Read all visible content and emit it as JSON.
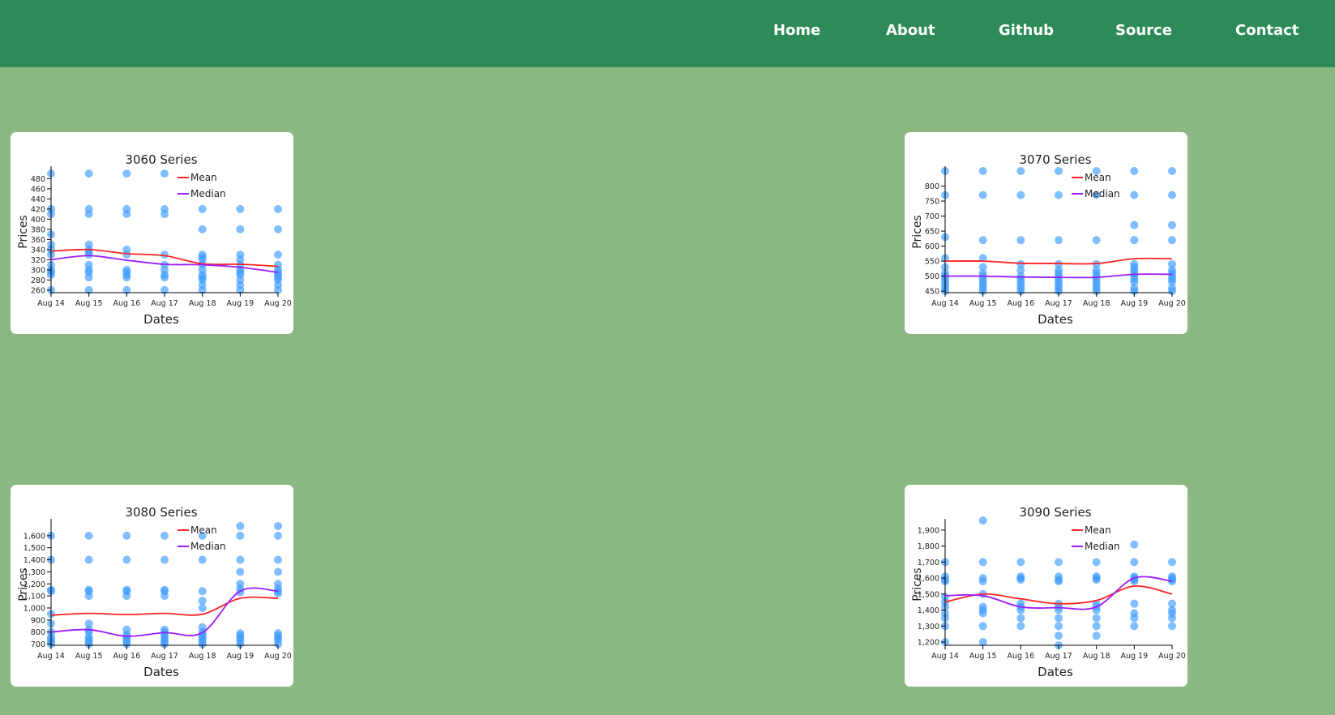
{
  "nav": {
    "items": [
      {
        "label": "Home"
      },
      {
        "label": "About"
      },
      {
        "label": "Github"
      },
      {
        "label": "Source"
      },
      {
        "label": "Contact"
      }
    ]
  },
  "colors": {
    "header": "#2e8b57",
    "background": "#8bb881",
    "mean": "#ff2222",
    "median": "#9b1bff",
    "points": "#3d9bff"
  },
  "chart_data": [
    {
      "type": "scatter",
      "title": "3060 Series",
      "xlabel": "Dates",
      "ylabel": "Prices",
      "categories": [
        "Aug 14",
        "Aug 15",
        "Aug 16",
        "Aug 17",
        "Aug 18",
        "Aug 19",
        "Aug 20"
      ],
      "yticks": [
        260,
        280,
        300,
        320,
        340,
        360,
        380,
        400,
        420,
        440,
        460,
        480
      ],
      "ylim": [
        255,
        495
      ],
      "tick_format": "plain",
      "points": [
        [
          490,
          420,
          410,
          370,
          350,
          340,
          330,
          310,
          300,
          295,
          290,
          260
        ],
        [
          490,
          420,
          410,
          350,
          340,
          335,
          330,
          310,
          300,
          295,
          285,
          260
        ],
        [
          490,
          420,
          410,
          340,
          330,
          300,
          295,
          290,
          285,
          260
        ],
        [
          490,
          420,
          410,
          330,
          310,
          300,
          290,
          285,
          260
        ],
        [
          420,
          380,
          330,
          325,
          320,
          310,
          300,
          290,
          285,
          280,
          270,
          260
        ],
        [
          420,
          380,
          330,
          320,
          310,
          300,
          295,
          290,
          280,
          270,
          260
        ],
        [
          420,
          380,
          330,
          310,
          300,
          295,
          290,
          285,
          280,
          270,
          260
        ]
      ],
      "series": [
        {
          "name": "Mean",
          "values": [
            337,
            340,
            332,
            328,
            312,
            311,
            307
          ]
        },
        {
          "name": "Median",
          "values": [
            320,
            328,
            319,
            311,
            310,
            305,
            295
          ]
        }
      ],
      "legend": "top-right"
    },
    {
      "type": "scatter",
      "title": "3070 Series",
      "xlabel": "Dates",
      "ylabel": "Prices",
      "categories": [
        "Aug 14",
        "Aug 15",
        "Aug 16",
        "Aug 17",
        "Aug 18",
        "Aug 19",
        "Aug 20"
      ],
      "yticks": [
        450,
        500,
        550,
        600,
        650,
        700,
        750,
        800
      ],
      "ylim": [
        445,
        850
      ],
      "tick_format": "plain",
      "points": [
        [
          850,
          770,
          630,
          560,
          530,
          510,
          500,
          490,
          480,
          470,
          460,
          450
        ],
        [
          850,
          770,
          620,
          560,
          530,
          510,
          500,
          490,
          480,
          470,
          460,
          450
        ],
        [
          850,
          770,
          620,
          540,
          520,
          500,
          490,
          480,
          470,
          460,
          450
        ],
        [
          850,
          770,
          620,
          540,
          520,
          510,
          500,
          490,
          480,
          470,
          460,
          450
        ],
        [
          850,
          770,
          620,
          540,
          520,
          510,
          500,
          490,
          480,
          470,
          460,
          450
        ],
        [
          850,
          770,
          670,
          620,
          540,
          530,
          520,
          510,
          500,
          490,
          480,
          460,
          450
        ],
        [
          850,
          770,
          670,
          620,
          540,
          520,
          510,
          500,
          490,
          480,
          460,
          450
        ]
      ],
      "series": [
        {
          "name": "Mean",
          "values": [
            550,
            550,
            543,
            542,
            542,
            558,
            558
          ]
        },
        {
          "name": "Median",
          "values": [
            500,
            500,
            497,
            496,
            496,
            506,
            506
          ]
        }
      ],
      "legend": "top-right"
    },
    {
      "type": "scatter",
      "title": "3080 Series",
      "xlabel": "Dates",
      "ylabel": "Prices",
      "categories": [
        "Aug 14",
        "Aug 15",
        "Aug 16",
        "Aug 17",
        "Aug 18",
        "Aug 19",
        "Aug 20"
      ],
      "yticks": [
        700,
        800,
        900,
        1000,
        1100,
        1200,
        1300,
        1400,
        1500,
        1600
      ],
      "ylim": [
        690,
        1700
      ],
      "tick_format": "comma",
      "points": [
        [
          1600,
          1400,
          1150,
          1140,
          950,
          870,
          800,
          760,
          740,
          720,
          700
        ],
        [
          1600,
          1400,
          1150,
          1140,
          1100,
          870,
          820,
          800,
          760,
          740,
          720,
          700
        ],
        [
          1600,
          1400,
          1150,
          1140,
          1100,
          820,
          780,
          760,
          740,
          720,
          700
        ],
        [
          1600,
          1400,
          1150,
          1140,
          1100,
          820,
          800,
          780,
          760,
          740,
          720,
          700
        ],
        [
          1600,
          1400,
          1140,
          1060,
          1000,
          840,
          800,
          780,
          760,
          740,
          720,
          700
        ],
        [
          1680,
          1600,
          1400,
          1300,
          1200,
          1160,
          1130,
          790,
          770,
          750,
          730,
          700
        ],
        [
          1680,
          1600,
          1400,
          1300,
          1200,
          1160,
          1140,
          1120,
          790,
          770,
          750,
          730,
          700
        ]
      ],
      "series": [
        {
          "name": "Mean",
          "values": [
            940,
            955,
            945,
            955,
            948,
            1080,
            1080
          ]
        },
        {
          "name": "Median",
          "values": [
            800,
            820,
            765,
            795,
            795,
            1140,
            1140
          ]
        }
      ],
      "legend": "top-right"
    },
    {
      "type": "scatter",
      "title": "3090 Series",
      "xlabel": "Dates",
      "ylabel": "Prices",
      "categories": [
        "Aug 14",
        "Aug 15",
        "Aug 16",
        "Aug 17",
        "Aug 18",
        "Aug 19",
        "Aug 20"
      ],
      "yticks": [
        1200,
        1300,
        1400,
        1500,
        1600,
        1700,
        1800,
        1900
      ],
      "ylim": [
        1180,
        1940
      ],
      "tick_format": "comma",
      "points": [
        [
          1700,
          1610,
          1590,
          1580,
          1480,
          1450,
          1420,
          1380,
          1350,
          1300,
          1200
        ],
        [
          1960,
          1700,
          1600,
          1580,
          1500,
          1420,
          1400,
          1380,
          1300,
          1200
        ],
        [
          1700,
          1610,
          1600,
          1590,
          1440,
          1420,
          1400,
          1350,
          1300
        ],
        [
          1700,
          1610,
          1590,
          1580,
          1440,
          1420,
          1400,
          1350,
          1300,
          1240,
          1180
        ],
        [
          1700,
          1610,
          1600,
          1590,
          1440,
          1420,
          1400,
          1350,
          1300,
          1240
        ],
        [
          1810,
          1700,
          1610,
          1600,
          1590,
          1580,
          1440,
          1380,
          1350,
          1300
        ],
        [
          1700,
          1610,
          1600,
          1590,
          1580,
          1440,
          1400,
          1380,
          1350,
          1300
        ]
      ],
      "series": [
        {
          "name": "Mean",
          "values": [
            1450,
            1500,
            1470,
            1440,
            1460,
            1550,
            1500
          ]
        },
        {
          "name": "Median",
          "values": [
            1490,
            1490,
            1420,
            1415,
            1420,
            1600,
            1580
          ]
        }
      ],
      "legend": "top-right"
    }
  ]
}
